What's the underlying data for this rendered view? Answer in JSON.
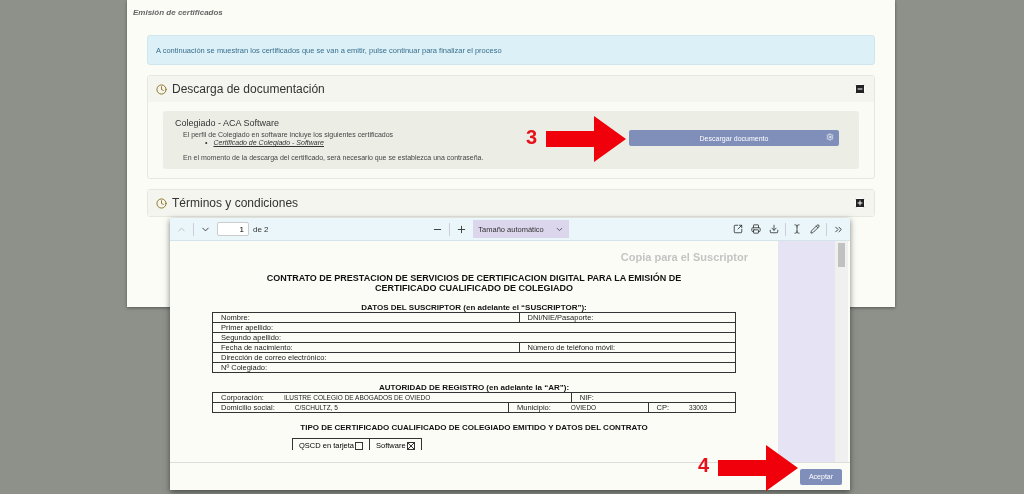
{
  "page": {
    "title": "Emisión de certificados",
    "info": "A continuación se muestran los certificados que se van a emitir, pulse continuar para finalizar el proceso",
    "sections": [
      {
        "title": "Descarga de documentación",
        "expanded": true,
        "profile": {
          "name": "Colegiado - ACA Software",
          "description": "El perfil de Colegiado en software incluye los siguientes certificados",
          "bullet": "•",
          "certificates": [
            "Certificado de Colegiado - Software"
          ],
          "note": "En el momento de la descarga del certificado, será necesario que se establezca una contraseña.",
          "button": "Descargar documento"
        }
      },
      {
        "title": "Términos y condiciones",
        "expanded": false
      }
    ]
  },
  "annotations": [
    {
      "label": "3"
    },
    {
      "label": "4"
    }
  ],
  "viewer": {
    "toolbar": {
      "previous_disabled": true,
      "page": "1",
      "page_count": "de 2",
      "zoom": "Tamaño automático"
    },
    "document": {
      "stamp": "Copia para el Suscriptor",
      "title_lines": [
        "CONTRATO DE PRESTACION DE SERVICIOS DE CERTIFICACION DIGITAL PARA LA EMISIÓN DE",
        "CERTIFICADO CUALIFICADO DE COLEGIADO"
      ],
      "tables": [
        {
          "heading": "DATOS DEL SUSCRIPTOR  (en adelante el “SUSCRIPTOR”):",
          "rows": [
            [
              {
                "label": "Nombre:"
              },
              {
                "label": "DNI/NIE/Pasaporte:"
              }
            ],
            [
              {
                "label": "Primer apellido:"
              }
            ],
            [
              {
                "label": "Segundo apellido:"
              }
            ],
            [
              {
                "label": "Fecha de nacimiento:"
              },
              {
                "label": "Número de teléfono móvil:"
              }
            ],
            [
              {
                "label": "Dirección de correo electrónico:"
              }
            ],
            [
              {
                "label": "Nº Colegiado:"
              }
            ]
          ]
        },
        {
          "heading": "AUTORIDAD DE REGISTRO (en adelante la “AR”):",
          "rows": [
            [
              {
                "label": "Corporación:",
                "value": "ILUSTRE COLEGIO DE ABOGADOS DE OVIEDO"
              },
              {
                "label": "NIF:"
              }
            ],
            [
              {
                "label": "Domicilio social:",
                "value": "C/SCHULTZ, 5"
              },
              {
                "label": "Municipio:",
                "value": "OVIEDO"
              },
              {
                "label": "CP:",
                "value": "33003"
              }
            ]
          ]
        }
      ],
      "type_heading": "TIPO DE CERTIFICADO CUALIFICADO DE COLEGIADO EMITIDO Y DATOS DEL CONTRATO",
      "options": [
        {
          "label": "QSCD en tarjeta",
          "checked": false
        },
        {
          "label": "Software",
          "checked": true
        }
      ]
    },
    "accept_button": "Aceptar"
  }
}
